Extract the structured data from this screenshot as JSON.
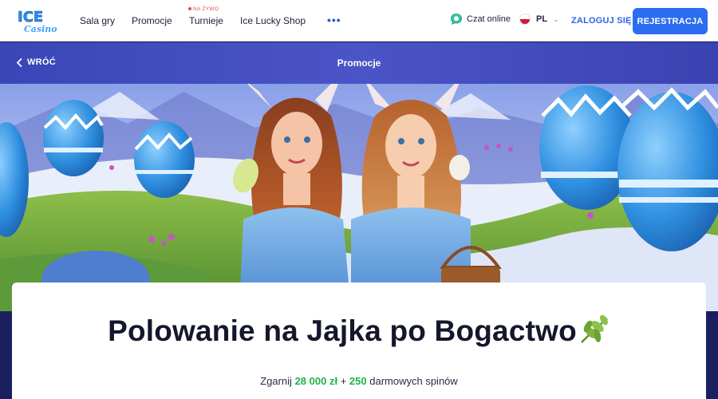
{
  "navbar": {
    "logo_text_top": "ICE",
    "logo_text_bottom": "Casino",
    "items": [
      {
        "label": "Sala gry"
      },
      {
        "label": "Promocje"
      },
      {
        "label": "Turnieje",
        "badge": "NA ŻYWO"
      },
      {
        "label": "Ice Lucky Shop"
      }
    ],
    "more_label": "•••",
    "chat_label": "Czat online",
    "language": "PL",
    "login_label": "ZALOGUJ SIĘ",
    "register_label": "REJESTRACJA"
  },
  "subheader": {
    "back_label": "WRÓĆ",
    "title": "Promocje"
  },
  "promo": {
    "title": "Polowanie na Jajka po Bogactwo",
    "title_emoji_icon": "herb-leaf-icon",
    "subtitle_prefix": "Zgarnij",
    "subtitle_amount": "28 000 zł",
    "subtitle_plus": "+",
    "subtitle_spins_count": "250",
    "subtitle_suffix": "darmowych spinów"
  },
  "colors": {
    "accent_blue": "#2c6cf0",
    "subheader_purple": "#4048bd",
    "highlight_green": "#1fb24a",
    "live_red": "#e14d4d"
  }
}
